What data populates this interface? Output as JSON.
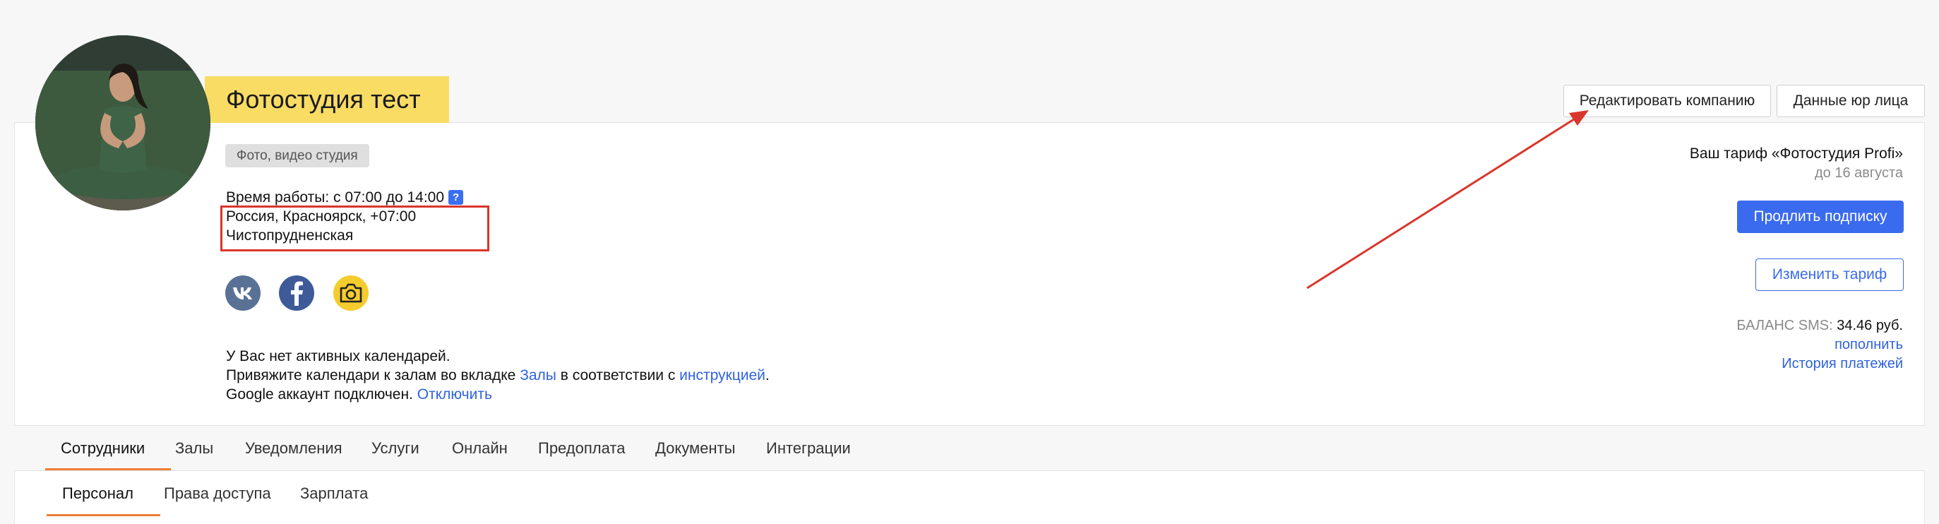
{
  "company": {
    "name": "Фотостудия тест",
    "category": "Фото, видео студия",
    "working_hours": "Время работы: с 07:00 до 14:00",
    "help_mark": "?",
    "location": "Россия, Красноярск, +07:00",
    "address": "Чистопрудненская"
  },
  "header_buttons": {
    "edit_company": "Редактировать компанию",
    "legal_data": "Данные юр лица"
  },
  "socials": [
    {
      "name": "vk",
      "color": "#5a7196"
    },
    {
      "name": "facebook",
      "color": "#3e5a99"
    },
    {
      "name": "photo-camera",
      "color": "#f5cc2d"
    }
  ],
  "calendar": {
    "line1": "У Вас нет активных календарей.",
    "line2_prefix": "Привяжите календари к залам во вкладке ",
    "line2_link1": "Залы",
    "line2_middle": " в соответствии с ",
    "line2_link2": "инструкцией",
    "line2_suffix": ".",
    "line3_prefix": "Google аккаунт подключен. ",
    "line3_link": "Отключить"
  },
  "subscription": {
    "tariff": "Ваш тариф «Фотостудия Profi»",
    "until": "до 16 августа",
    "renew_button": "Продлить подписку",
    "change_button": "Изменить тариф",
    "sms_label": "БАЛАНС SMS:",
    "sms_value": "34.46 руб.",
    "topup_link": "пополнить",
    "history_link": "История платежей"
  },
  "tabs": [
    "Сотрудники",
    "Залы",
    "Уведомления",
    "Услуги",
    "Онлайн",
    "Предоплата",
    "Документы",
    "Интеграции"
  ],
  "subtabs": [
    "Персонал",
    "Права доступа",
    "Зарплата"
  ],
  "colors": {
    "accent": "#ee7d38",
    "primary": "#3a6bef",
    "title_bg": "#f9dc64",
    "annotation": "#d9362b"
  }
}
